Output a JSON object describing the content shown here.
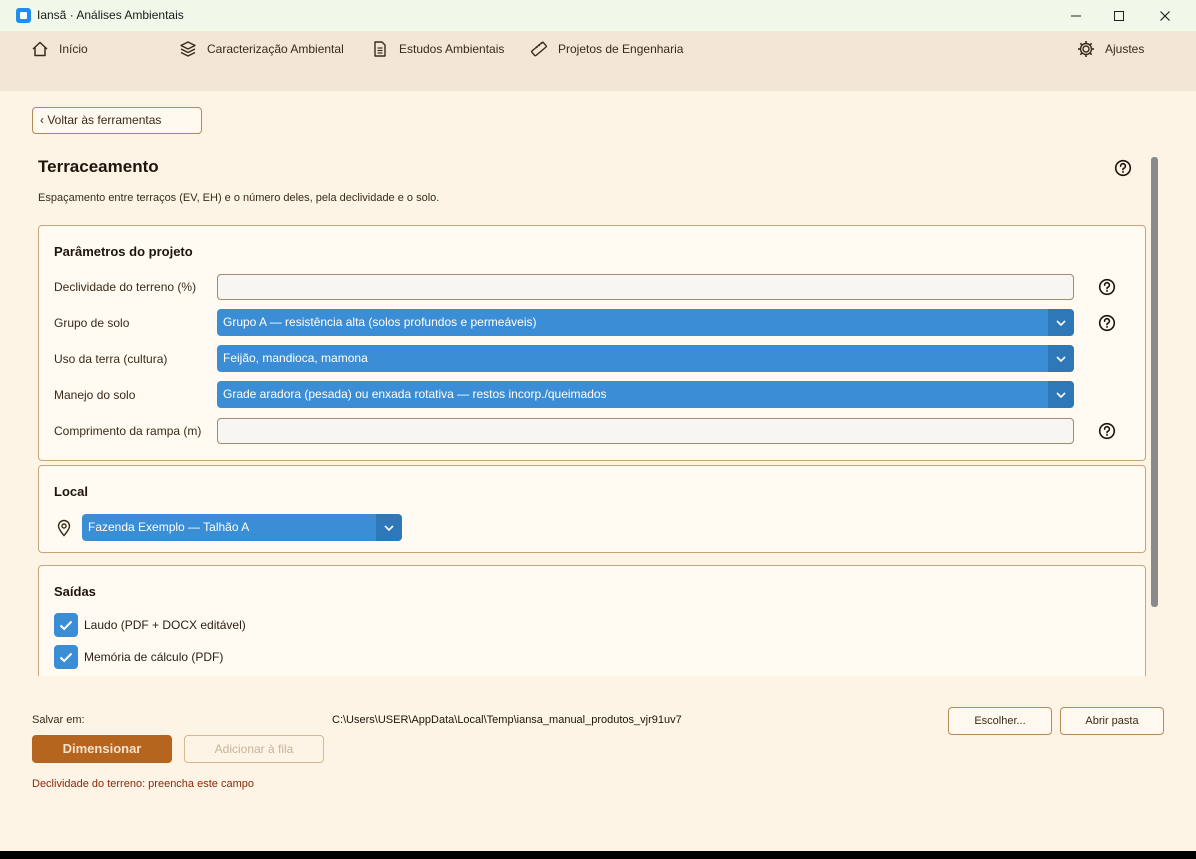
{
  "window": {
    "title": "Iansã · Análises Ambientais"
  },
  "nav": {
    "items": [
      {
        "label": "Início",
        "icon": "home-icon"
      },
      {
        "label": "Caracterização Ambiental",
        "icon": "layers-icon"
      },
      {
        "label": "Estudos Ambientais",
        "icon": "document-icon"
      },
      {
        "label": "Projetos de Engenharia",
        "icon": "ruler-icon"
      }
    ],
    "settings_label": "Ajustes"
  },
  "back_button": "‹ Voltar às ferramentas",
  "page": {
    "title": "Terraceamento",
    "subtitle": "Espaçamento entre terraços (EV, EH) e o número deles, pela declividade e o solo."
  },
  "params": {
    "title": "Parâmetros do projeto",
    "slope_label": "Declividade do terreno (%)",
    "slope_value": "",
    "soil_group_label": "Grupo de solo",
    "soil_group_value": "Grupo A — resistência alta (solos profundos e permeáveis)",
    "land_use_label": "Uso da terra (cultura)",
    "land_use_value": "Feijão, mandioca, mamona",
    "management_label": "Manejo do solo",
    "management_value": "Grade aradora (pesada) ou enxada rotativa — restos incorp./queimados",
    "ramp_label": "Comprimento da rampa (m)",
    "ramp_value": ""
  },
  "local": {
    "title": "Local",
    "value": "Fazenda Exemplo — Talhão A"
  },
  "outputs": {
    "title": "Saídas",
    "items": [
      {
        "label": "Laudo (PDF + DOCX editável)",
        "checked": true
      },
      {
        "label": "Memória de cálculo (PDF)",
        "checked": true
      }
    ]
  },
  "footer": {
    "save_label": "Salvar em:",
    "save_path": "C:\\Users\\USER\\AppData\\Local\\Temp\\iansa_manual_produtos_vjr91uv7",
    "choose_label": "Escolher...",
    "open_folder_label": "Abrir pasta",
    "run_label": "Dimensionar",
    "queue_label": "Adicionar à fila",
    "error": "Declividade do terreno: preencha este campo"
  },
  "colors": {
    "accent": "#3b8ed6",
    "primary_button": "#b5651d",
    "background": "#fdf4e6",
    "error": "#8a2a0a"
  }
}
